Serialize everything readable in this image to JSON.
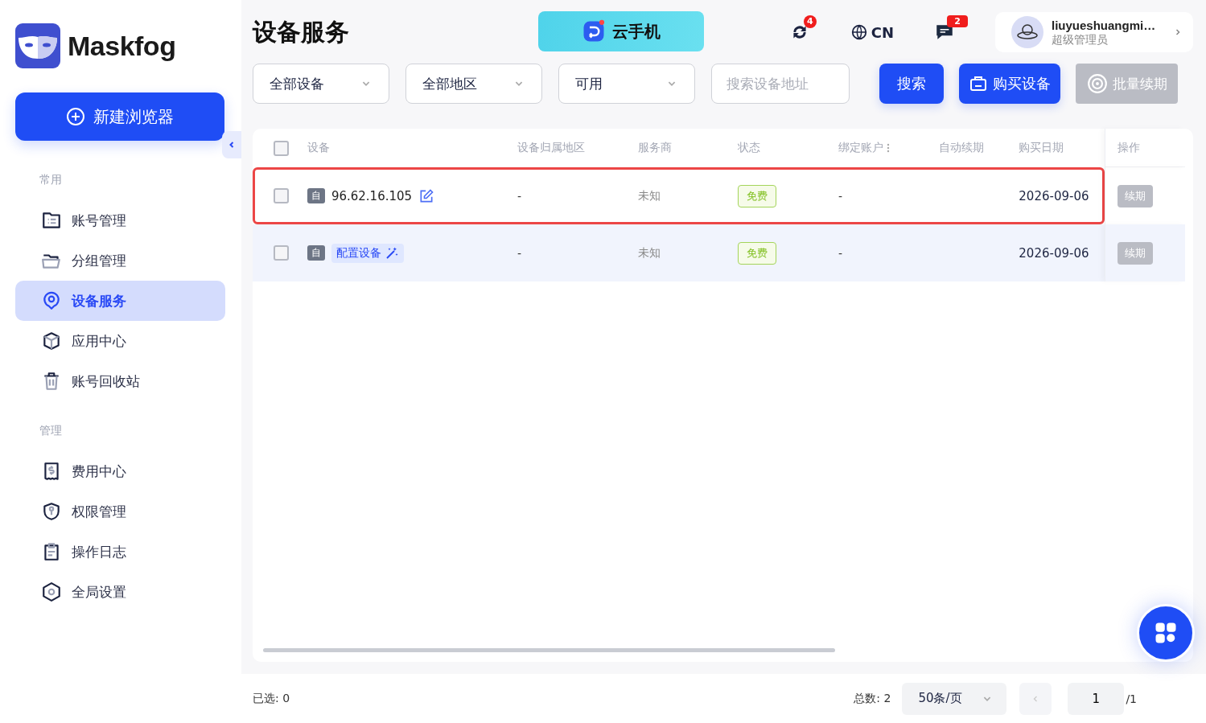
{
  "brand": {
    "name": "Maskfog"
  },
  "new_button": {
    "label": "新建浏览器"
  },
  "sidebar": {
    "sections": [
      {
        "label": "常用",
        "items": [
          {
            "label": "账号管理",
            "selected": false
          },
          {
            "label": "分组管理",
            "selected": false
          },
          {
            "label": "设备服务",
            "selected": true
          },
          {
            "label": "应用中心",
            "selected": false
          },
          {
            "label": "账号回收站",
            "selected": false
          }
        ]
      },
      {
        "label": "管理",
        "items": [
          {
            "label": "费用中心",
            "selected": false
          },
          {
            "label": "权限管理",
            "selected": false
          },
          {
            "label": "操作日志",
            "selected": false
          },
          {
            "label": "全局设置",
            "selected": false
          }
        ]
      }
    ]
  },
  "header": {
    "title": "设备服务",
    "banner": "云手机",
    "sync_badge": "4",
    "language": "CN",
    "message_badge": "2",
    "user": {
      "name": "liuyueshuangmi…",
      "role": "超级管理员"
    }
  },
  "filters": {
    "selects": [
      "全部设备",
      "全部地区",
      "可用"
    ],
    "search": {
      "placeholder": "搜索设备地址"
    },
    "buttons": [
      {
        "label": "搜索",
        "kind": "search",
        "disabled": false
      },
      {
        "label": "购买设备",
        "kind": "buy",
        "disabled": false
      },
      {
        "label": "批量续期",
        "kind": "renew",
        "disabled": true
      }
    ]
  },
  "table": {
    "select_all": {
      "checked": false
    },
    "columns": [
      "设备",
      "设备归属地区",
      "服务商",
      "状态",
      "绑定账户",
      "自动续期",
      "购买日期",
      "操作"
    ],
    "rows": [
      {
        "checked": false,
        "highlighted": true,
        "hovered": false,
        "type_tag": "自",
        "kind": "address",
        "device": "96.62.16.105",
        "region": "-",
        "provider": "未知",
        "status": "免费",
        "account": "-",
        "purchase_date": "2026-09-06",
        "action": "续期"
      },
      {
        "checked": false,
        "highlighted": false,
        "hovered": true,
        "type_tag": "自",
        "kind": "configure",
        "device": "配置设备",
        "region": "-",
        "provider": "未知",
        "status": "免费",
        "account": "-",
        "purchase_date": "2026-09-06",
        "action": "续期"
      }
    ]
  },
  "footer": {
    "selected": "已选: 0",
    "total": "总数: 2",
    "page_size": "50条/页",
    "page": "1",
    "page_count": "/1"
  }
}
